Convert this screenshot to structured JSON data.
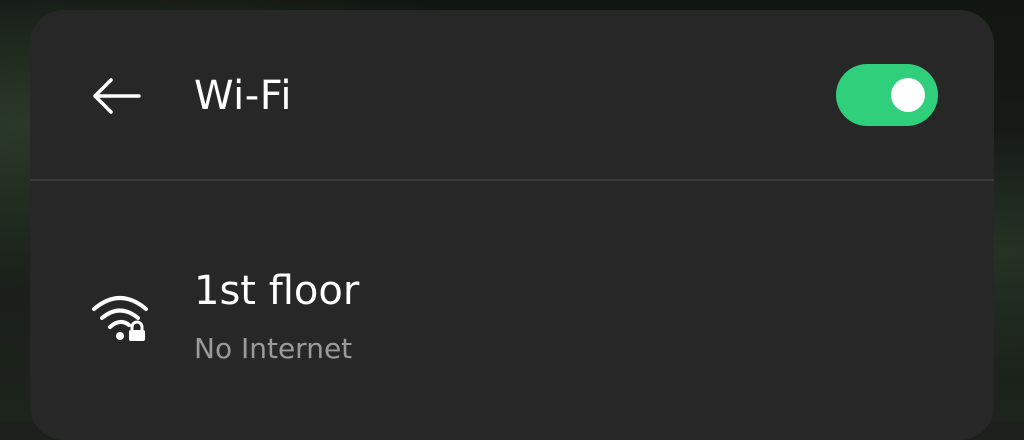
{
  "header": {
    "back_icon": "arrow-left-icon",
    "title": "Wi-Fi",
    "toggle": {
      "state": "on",
      "color": "#2fcf7c"
    }
  },
  "networks": [
    {
      "icon": "wifi-lock-icon",
      "name": "1st floor",
      "status": "No Internet"
    }
  ],
  "colors": {
    "panel": "#272727",
    "text_primary": "#ffffff",
    "text_secondary": "#9a9a9a",
    "accent": "#2fcf7c"
  }
}
